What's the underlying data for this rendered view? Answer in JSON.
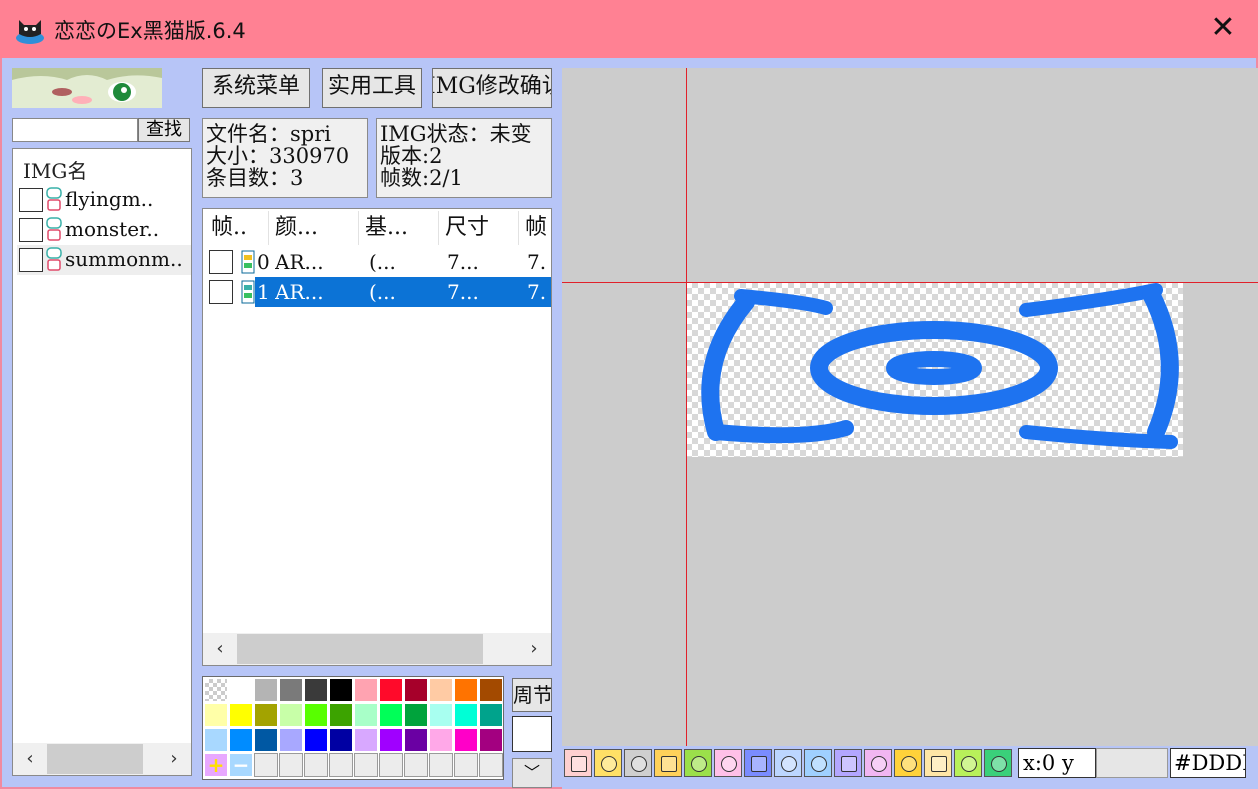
{
  "window": {
    "title": "恋恋のEx黑猫版.6.4",
    "close_glyph": "✕",
    "accent": "#ff8193"
  },
  "search": {
    "value": "",
    "button_label": "查找"
  },
  "img_list": {
    "header": "IMG名",
    "items": [
      {
        "label": "flyingm..",
        "selected": false
      },
      {
        "label": "monster..",
        "selected": false
      },
      {
        "label": "summonm..",
        "selected": true
      }
    ]
  },
  "toolbar_top": {
    "system_menu": "系统菜单",
    "tools": "实用工具",
    "img_confirm": "IMG修改确认"
  },
  "file_info": {
    "filename": "文件名：spri",
    "size": "大小：330970",
    "entries": "条目数：3"
  },
  "img_info": {
    "status": "IMG状态：未变",
    "version": "版本:2",
    "frames": "帧数:2/1"
  },
  "frame_table": {
    "columns": [
      "帧..",
      "颜...",
      "基...",
      "尺寸",
      "帧"
    ],
    "rows": [
      {
        "index": "0",
        "color": "AR...",
        "base": "(...",
        "size": "7...",
        "frame": "7.",
        "selected": false
      },
      {
        "index": "1",
        "color": "AR...",
        "base": "(...",
        "size": "7...",
        "frame": "7.",
        "selected": true
      }
    ]
  },
  "palette": {
    "rows": [
      [
        "transparent",
        "#ffffff",
        "#b4b4b4",
        "#7a7a7a",
        "#3a3a3a",
        "#000000",
        "#ffa3b1",
        "#ff0a2a",
        "#a6002a",
        "#ffcba4",
        "#ff7300",
        "#a34a00"
      ],
      [
        "#ffffa8",
        "#ffff00",
        "#a3a300",
        "#c8ffa8",
        "#58ff00",
        "#3ca300",
        "#a8ffc8",
        "#00ff58",
        "#00a33c",
        "#a8fff0",
        "#00ffd6",
        "#00a38c"
      ],
      [
        "#a8d8ff",
        "#008cff",
        "#0058a3",
        "#a8a8ff",
        "#0000ff",
        "#0000a3",
        "#d8a8ff",
        "#a000ff",
        "#6a00a3",
        "#ffa8e8",
        "#ff00c8",
        "#a30080"
      ]
    ],
    "add_glyph": "+",
    "remove_glyph": "−",
    "period_label": "周节",
    "selected_color": "#ffffff",
    "dropdown_glyph": "﹀"
  },
  "scroll": {
    "left_glyph": "‹",
    "right_glyph": "›"
  },
  "canvas": {
    "background": "#cccccc",
    "guide_color": "#e0202a",
    "sprite_color": "#1e73f0",
    "tools": [
      {
        "name": "grid-tool-icon",
        "color": "#ffd0d0"
      },
      {
        "name": "palette-tool-icon",
        "color": "#ffe066"
      },
      {
        "name": "film-tool-icon",
        "color": "#cfcfcf"
      },
      {
        "name": "frames-tool-icon",
        "color": "#ffd15a"
      },
      {
        "name": "clapper-tool-icon",
        "color": "#9be04a"
      },
      {
        "name": "cloud-tool-icon",
        "color": "#ffc0e8"
      },
      {
        "name": "zoom-tool-icon",
        "color": "#7a8cff"
      },
      {
        "name": "move-tool-icon",
        "color": "#bcd6ff"
      },
      {
        "name": "crop-tool-icon",
        "color": "#9fd0ff"
      },
      {
        "name": "pen-tool-icon",
        "color": "#b3a6ff"
      },
      {
        "name": "line-tool-icon",
        "color": "#f2b6f2"
      },
      {
        "name": "rectangle-tool-icon",
        "color": "#ffd23a"
      },
      {
        "name": "eraser-tool-icon",
        "color": "#ffe6a6"
      },
      {
        "name": "eyedropper-tool-icon",
        "color": "#b8f05a"
      },
      {
        "name": "bucket-tool-icon",
        "color": "#3ad07a"
      }
    ],
    "coord_text": "x:0 y",
    "hex_text": "#DDDD"
  }
}
